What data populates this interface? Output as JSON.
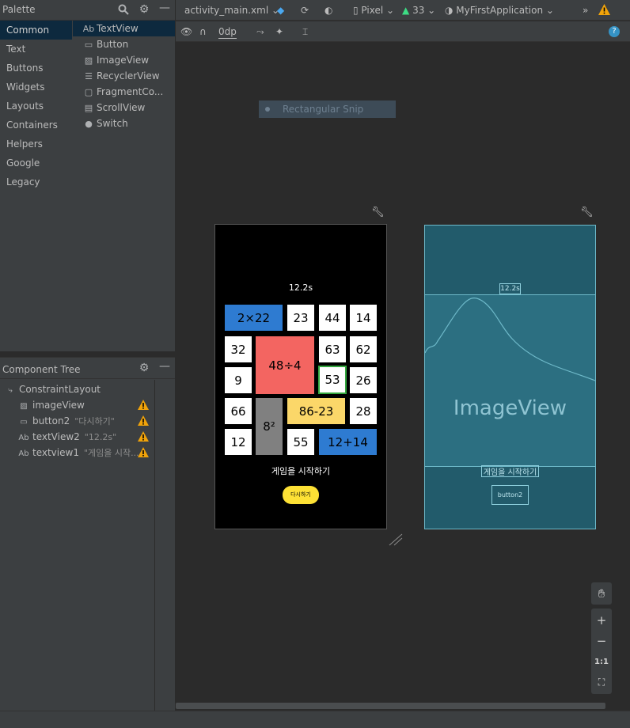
{
  "palette": {
    "title": "Palette",
    "categories": [
      "Common",
      "Text",
      "Buttons",
      "Widgets",
      "Layouts",
      "Containers",
      "Helpers",
      "Google",
      "Legacy"
    ],
    "items": [
      {
        "icon": "Ab",
        "label": "TextView"
      },
      {
        "icon": "▭",
        "label": "Button"
      },
      {
        "icon": "🖼",
        "label": "ImageView"
      },
      {
        "icon": "☰",
        "label": "RecyclerView"
      },
      {
        "icon": "▢",
        "label": "FragmentCo..."
      },
      {
        "icon": "▤",
        "label": "ScrollView"
      },
      {
        "icon": "●",
        "label": "Switch"
      }
    ]
  },
  "tree": {
    "title": "Component Tree",
    "rows": [
      {
        "icon": "⤷",
        "label": "ConstraintLayout",
        "sub": "",
        "warn": false
      },
      {
        "icon": "▨",
        "label": "imageView",
        "sub": "",
        "warn": true
      },
      {
        "icon": "▭",
        "label": "button2",
        "sub": "\"다시하기\"",
        "warn": true
      },
      {
        "icon": "Ab",
        "label": "textView2",
        "sub": "\"12.2s\"",
        "warn": true
      },
      {
        "icon": "Ab",
        "label": "textview1",
        "sub": "\"게임을 시작...",
        "warn": true
      }
    ]
  },
  "toolbar": {
    "file": "activity_main.xml",
    "device": "Pixel",
    "api": "33",
    "theme": "MyFirstApplication",
    "margin": "0dp",
    "more": "»"
  },
  "snip": {
    "label": "Rectangular Snip"
  },
  "phone": {
    "timer": "12.2s",
    "cells": [
      "2×22",
      "23",
      "44",
      "14",
      "32",
      "48÷4",
      "63",
      "62",
      "9",
      "53",
      "26",
      "66",
      "8²",
      "86-23",
      "28",
      "12",
      "55",
      "12+14"
    ],
    "start_text": "게임을 시작하기",
    "retry_button": "다시하기"
  },
  "blueprint": {
    "timer": "12.2s",
    "image_label": "ImageView",
    "start_text": "게임을 시작하기",
    "button_label": "button2"
  },
  "zoom": {
    "plus": "+",
    "minus": "−",
    "one_to_one": "1:1"
  },
  "colors": {
    "accent": "#2e7bd1",
    "warn": "#f0a30a",
    "selection": "#0d293e"
  }
}
